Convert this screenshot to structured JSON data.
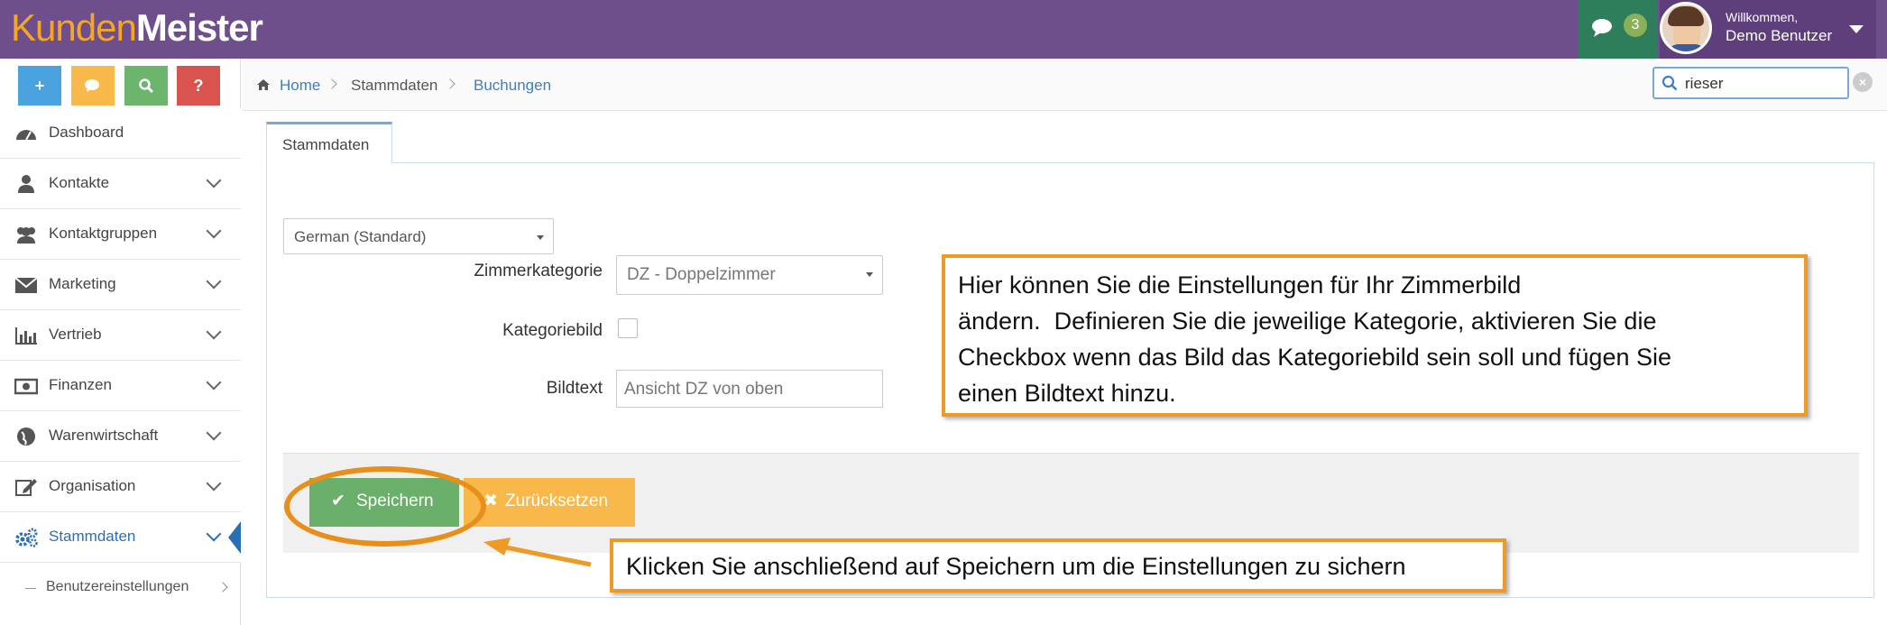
{
  "header": {
    "logo_part1": "Kunden",
    "logo_part2": "Meister",
    "message_count": "3",
    "welcome": "Willkommen,",
    "username": "Demo Benutzer"
  },
  "quick_actions": {
    "add": "+",
    "help": "?"
  },
  "sidebar": {
    "items": [
      {
        "label": "Dashboard",
        "icon": "dashboard-icon"
      },
      {
        "label": "Kontakte",
        "icon": "user-icon"
      },
      {
        "label": "Kontaktgruppen",
        "icon": "users-icon"
      },
      {
        "label": "Marketing",
        "icon": "envelope-icon"
      },
      {
        "label": "Vertrieb",
        "icon": "bar-chart-icon"
      },
      {
        "label": "Finanzen",
        "icon": "money-icon"
      },
      {
        "label": "Warenwirtschaft",
        "icon": "globe-icon"
      },
      {
        "label": "Organisation",
        "icon": "edit-icon"
      },
      {
        "label": "Stammdaten",
        "icon": "cogs-icon"
      }
    ],
    "sub_items": [
      {
        "label": "Benutzereinstellungen"
      }
    ]
  },
  "breadcrumb": {
    "home": "Home",
    "level2": "Stammdaten",
    "level3": "Buchungen"
  },
  "search": {
    "value": "rieser",
    "clear": "×"
  },
  "tabs": [
    {
      "label": "Stammdaten"
    }
  ],
  "form": {
    "language": "German (Standard)",
    "zimmer_label": "Zimmerkategorie",
    "zimmer_value": "DZ - Doppelzimmer",
    "kategoriebild_label": "Kategoriebild",
    "kategoriebild_checked": false,
    "bildtext_label": "Bildtext",
    "bildtext_value": "Ansicht DZ von oben"
  },
  "buttons": {
    "save_icon": "✔",
    "save": "Speichern",
    "reset_icon": "✖",
    "reset": "Zurücksetzen"
  },
  "annotations": {
    "callout1_lines": [
      "Hier können Sie die Einstellungen für Ihr Zimmerbild",
      "ändern.  Definieren Sie die jeweilige Kategorie, aktivieren Sie die",
      "Checkbox wenn das Bild das Kategoriebild sein soll und fügen Sie",
      "einen Bildtext hinzu."
    ],
    "callout2": "Klicken Sie anschließend auf Speichern um die Einstellungen zu sichern"
  },
  "colors": {
    "header": "#6e4f8c",
    "accent_orange": "#ee9a26",
    "save_green": "#6aaf6a",
    "reset_orange": "#f8b84a",
    "link_blue": "#3f7fbf"
  }
}
